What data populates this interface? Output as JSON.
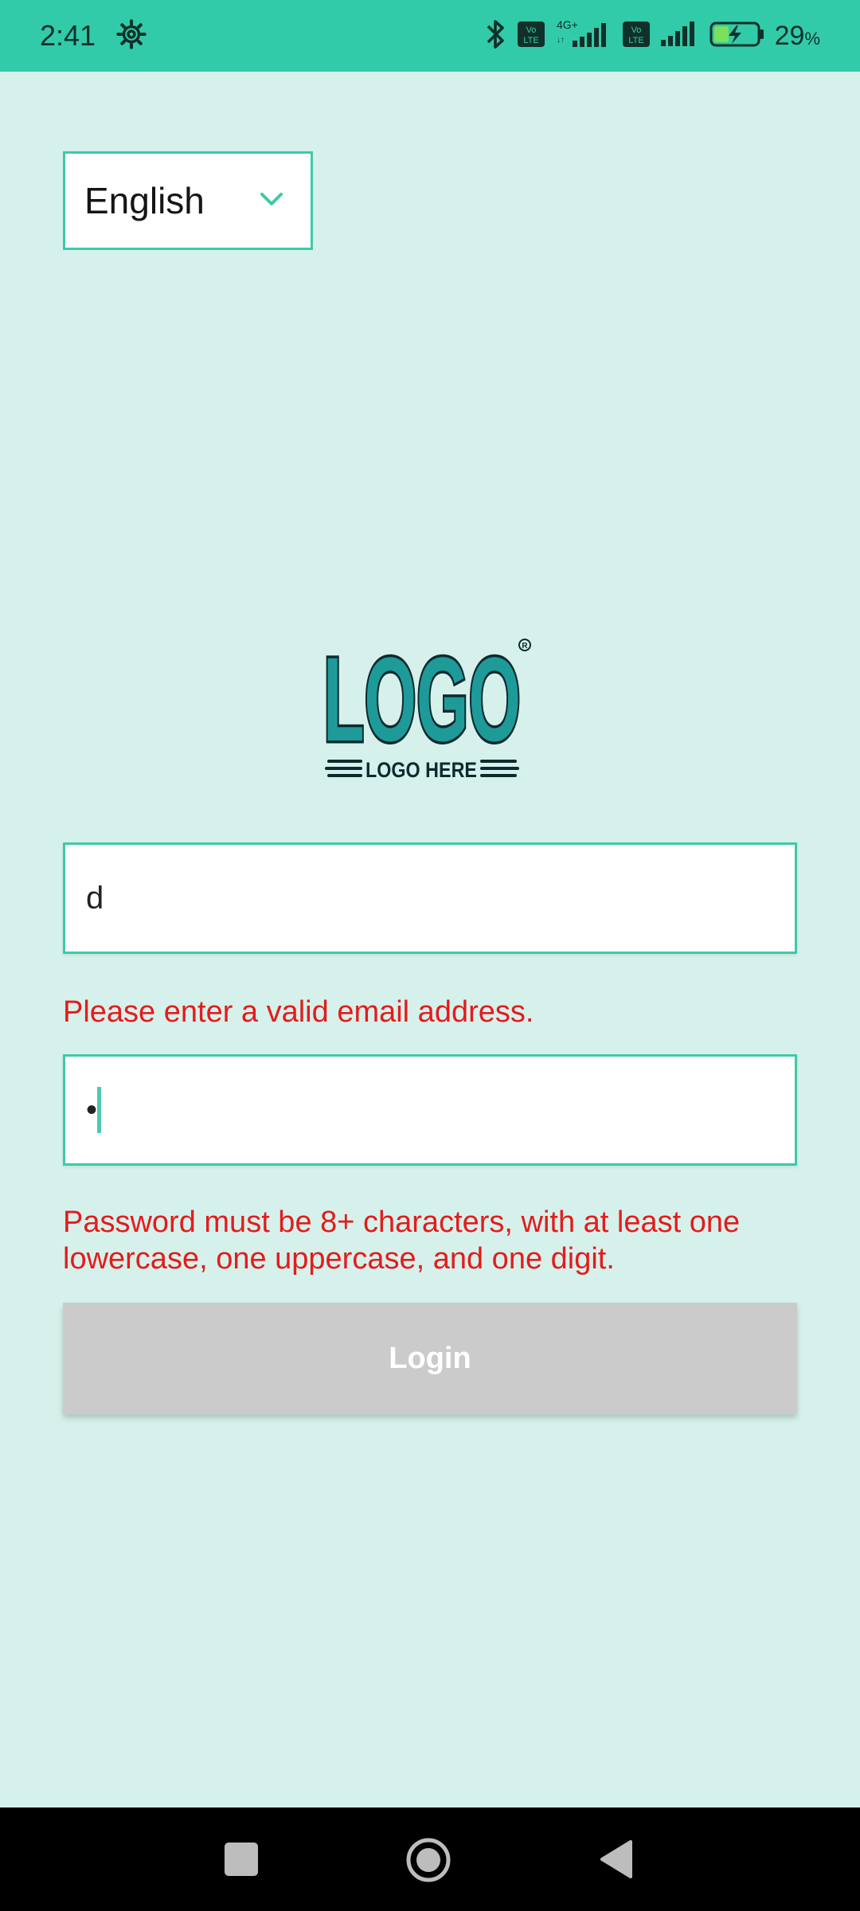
{
  "status_bar": {
    "time": "2:41",
    "battery_percent": "29",
    "battery_unit": "%",
    "network_label": "4G+",
    "volte_label": "Vo LTE",
    "icons": [
      "gear-icon",
      "bluetooth-icon",
      "volte-icon",
      "signal-icon",
      "battery-charging-icon"
    ],
    "background_color": "#31cba9"
  },
  "language": {
    "selected": "English"
  },
  "logo": {
    "main_text": "LOGO",
    "sub_text": "LOGO HERE"
  },
  "form": {
    "email_value": "d",
    "email_error": "Please enter a valid email address.",
    "password_value": "•",
    "password_error": "Password must be 8+ characters, with at least one lowercase, one uppercase, and one digit.",
    "login_label": "Login"
  },
  "colors": {
    "background": "#d6f1eb",
    "accent": "#3dcaa9",
    "error": "#e31c1c",
    "button_disabled": "#cbcbcb",
    "logo_fill": "#1e9a99",
    "logo_outline": "#0e2a2e"
  },
  "nav_bar": {
    "icons": [
      "recent-apps-icon",
      "home-icon",
      "back-icon"
    ]
  }
}
